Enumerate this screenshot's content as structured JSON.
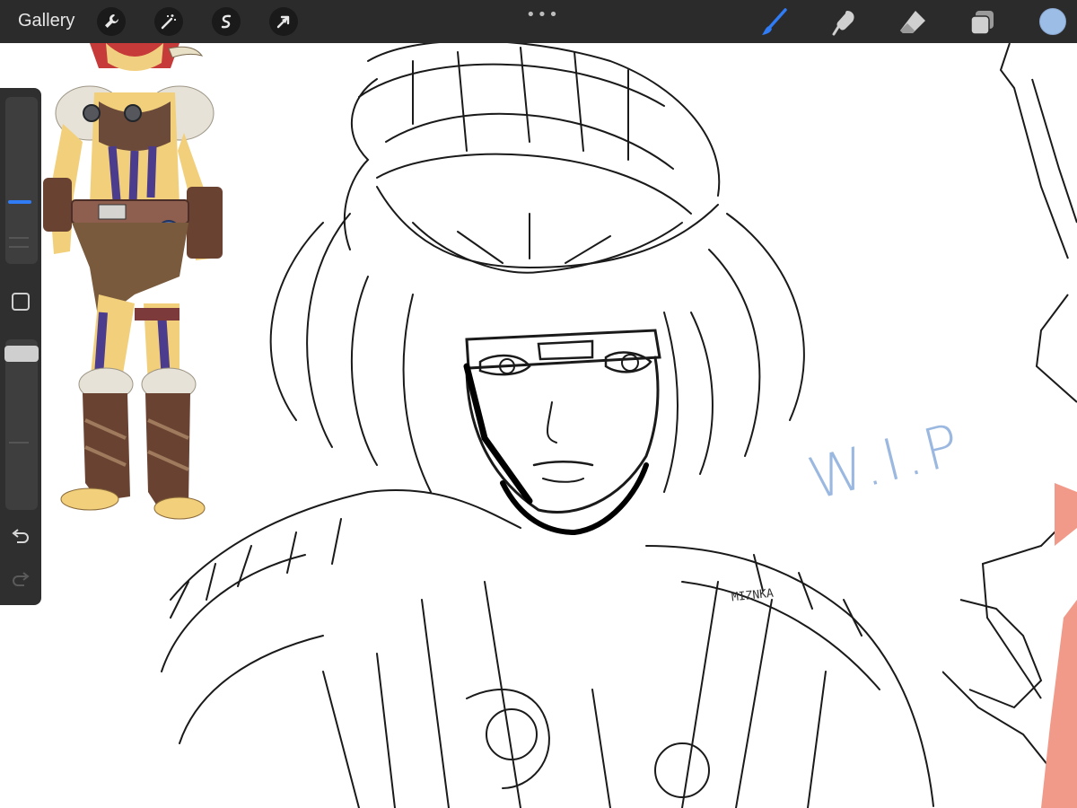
{
  "app": {
    "gallery_label": "Gallery",
    "more_icon": "more-dots-icon"
  },
  "toolbar_left": [
    {
      "name": "wrench-icon",
      "label": "Actions"
    },
    {
      "name": "magic-wand-icon",
      "label": "Adjustments"
    },
    {
      "name": "selection-icon",
      "label": "Selection"
    },
    {
      "name": "arrow-icon",
      "label": "Transform"
    }
  ],
  "toolbar_right": [
    {
      "name": "brush-icon",
      "label": "Paint",
      "active": true
    },
    {
      "name": "smudge-icon",
      "label": "Smudge",
      "active": false
    },
    {
      "name": "eraser-icon",
      "label": "Erase",
      "active": false
    },
    {
      "name": "layers-icon",
      "label": "Layers",
      "active": false
    }
  ],
  "colors": {
    "active_tool": "#2f7cf6",
    "current_color": "#9bbde6",
    "toolbar_bg": "#2b2b2b",
    "wip_text": "#9bb8e0",
    "accent_salmon": "#f19a8a"
  },
  "sidebar": {
    "brush_size": 0.35,
    "opacity": 0.96,
    "modify_icon": "square-modify-icon",
    "undo_icon": "undo-icon",
    "redo_icon": "redo-icon"
  },
  "canvas": {
    "watermark_text": "W.I.P",
    "signature_text": "MIZNKA"
  }
}
